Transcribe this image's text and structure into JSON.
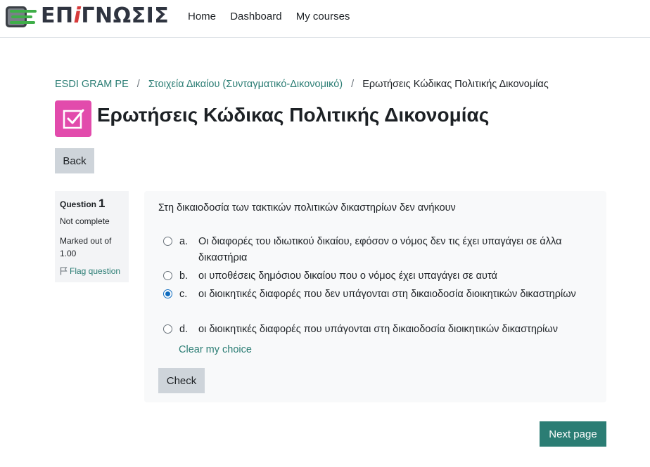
{
  "brand": {
    "logo_text_pre": "ΕΠ",
    "logo_text_accent": "i",
    "logo_text_post": "ΓΝΩΣΙΣ"
  },
  "nav": {
    "home": "Home",
    "dashboard": "Dashboard",
    "my_courses": "My courses"
  },
  "breadcrumb": {
    "items": [
      "ESDI GRAM PE",
      "Στοιχεία Δικαίου (Συνταγματικό-Δικονομικό)"
    ],
    "current": "Ερωτήσεις Κώδικας Πολιτικής Δικονομίας",
    "separator": "/"
  },
  "page": {
    "title": "Ερωτήσεις Κώδικας Πολιτικής Δικονομίας",
    "back_label": "Back",
    "icon": "checkbox-icon",
    "icon_color": "#e24bac"
  },
  "question_info": {
    "label": "Question",
    "number": "1",
    "state": "Not complete",
    "grade": "Marked out of 1.00",
    "flag_label": "Flag question"
  },
  "question": {
    "text": "Στη δικαιοδοσία των τακτικών πολιτικών δικαστηρίων δεν ανήκουν",
    "answers": [
      {
        "letter": "a.",
        "text": "Οι διαφορές του ιδιωτικού δικαίου, εφόσον ο νόμος δεν τις έχει υπαγάγει σε άλλα δικαστήρια",
        "checked": false
      },
      {
        "letter": "b.",
        "text": "οι υποθέσεις δημόσιου δικαίου που ο νόμος έχει υπαγάγει σε αυτά",
        "checked": false
      },
      {
        "letter": "c.",
        "text": "οι διοικητικές διαφορές που δεν υπάγονται στη δικαιοδοσία διοικητικών δικαστηρίων",
        "checked": true
      },
      {
        "letter": "d.",
        "text": "οι διοικητικές διαφορές που υπάγονται στη δικαιοδοσία διοικητικών δικαστηρίων",
        "checked": false
      }
    ],
    "clear_label": "Clear my choice",
    "check_label": "Check"
  },
  "footer": {
    "next_label": "Next page"
  },
  "colors": {
    "accent": "#2b7d74",
    "radio_selected": "#0f6cbf",
    "button_secondary": "#ced4da"
  }
}
